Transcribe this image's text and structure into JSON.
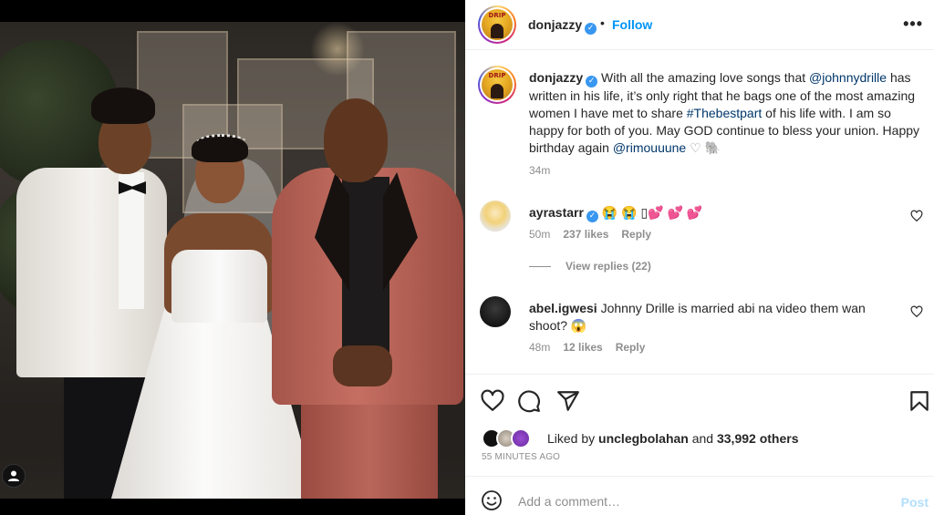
{
  "header": {
    "username": "donjazzy",
    "separator": "•",
    "follow_label": "Follow",
    "more_label": "•••"
  },
  "caption": {
    "username": "donjazzy",
    "text_part1": "With all the amazing love songs that ",
    "mention1": "@johnnydrille",
    "text_part2": " has written in his life, it’s only right that he bags one of the most amazing women I have met to share ",
    "hashtag": "#Thebestpart",
    "text_part3": " of his life with. I am so happy for both of you. May GOD continue to bless your union. Happy birthday again ",
    "mention2": "@rimouuune",
    "emojis": "♡ 🐘",
    "time": "34m"
  },
  "comments": [
    {
      "username": "ayrastarr",
      "text": "😭 😭 ▯💕 💕 💕",
      "time": "50m",
      "likes": "237 likes",
      "reply_label": "Reply"
    },
    {
      "username": "abel.igwesi",
      "text": "Johnny Drille is married abi na video them wan shoot? 😱",
      "time": "48m",
      "likes": "12 likes",
      "reply_label": "Reply"
    }
  ],
  "view_replies": "View replies (22)",
  "likes": {
    "prefix": "Liked by ",
    "user": "unclegbolahan",
    "middle": " and ",
    "count": "33,992 others"
  },
  "post_time": "55 MINUTES AGO",
  "comment_box": {
    "placeholder": "Add a comment…",
    "post_label": "Post"
  },
  "avatar_badge_text": "DRIP",
  "colors": {
    "link": "#00376b",
    "accent": "#0095f6",
    "verified": "#3897f0",
    "muted": "#8e8e8e",
    "post_disabled": "#b2dffc"
  }
}
